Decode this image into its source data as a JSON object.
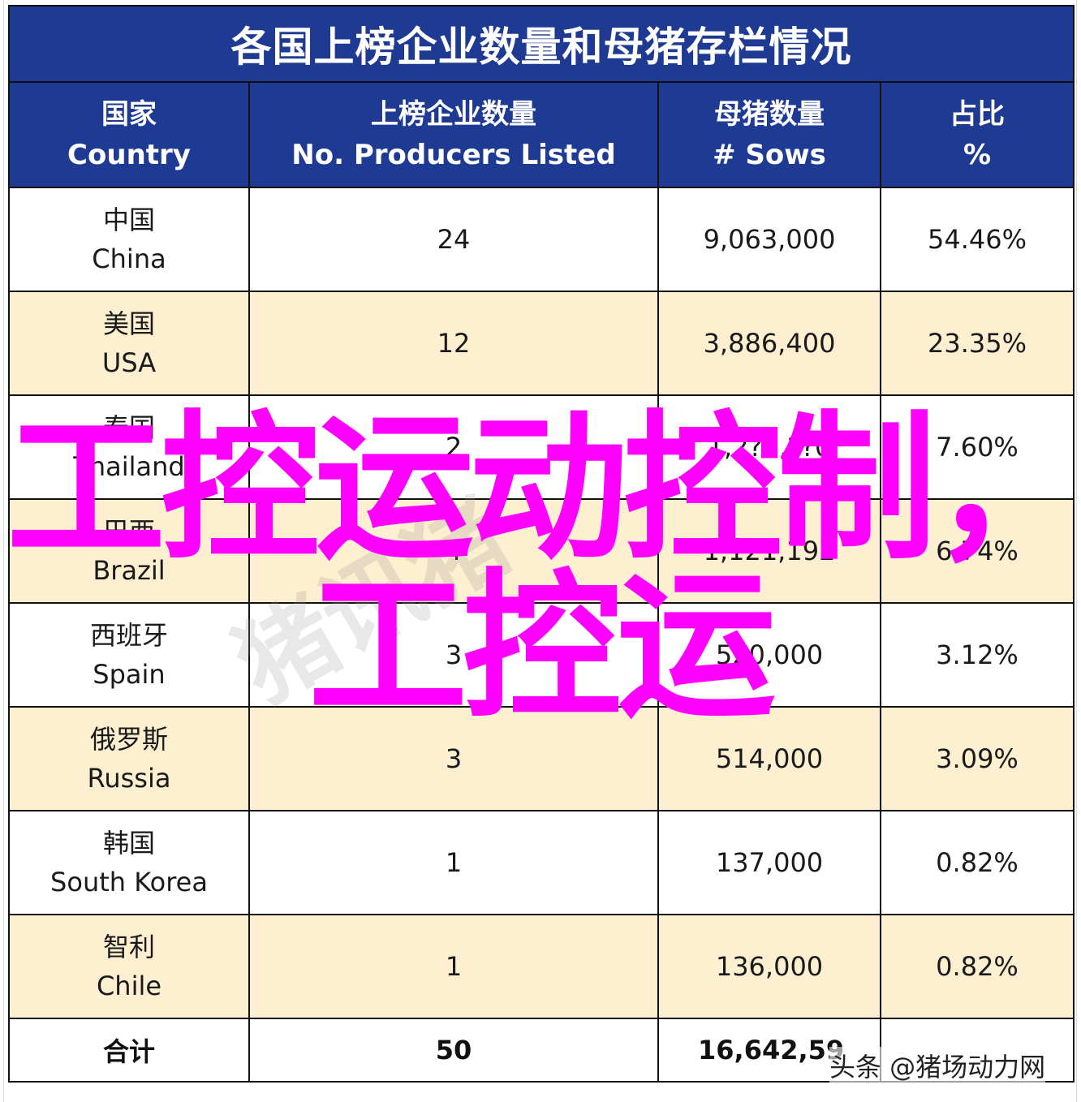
{
  "table": {
    "title": "各国上榜企业数量和母猪存栏情况",
    "headers": [
      {
        "zh": "国家",
        "en": "Country"
      },
      {
        "zh": "上榜企业数量",
        "en": "No. Producers Listed"
      },
      {
        "zh": "母猪数量",
        "en": "# Sows"
      },
      {
        "zh": "占比",
        "en": "%"
      }
    ],
    "rows": [
      {
        "country_zh": "中国",
        "country_en": "China",
        "producers": "24",
        "sows": "9,063,000",
        "share": "54.46%"
      },
      {
        "country_zh": "美国",
        "country_en": "USA",
        "producers": "12",
        "sows": "3,886,400",
        "share": "23.35%"
      },
      {
        "country_zh": "泰国",
        "country_en": "Thailand",
        "producers": "2",
        "sows": "1,2?5,??0",
        "share": "7.60%"
      },
      {
        "country_zh": "巴西",
        "country_en": "Brazil",
        "producers": "4",
        "sows": "1,121,192",
        "share": "6.74%"
      },
      {
        "country_zh": "西班牙",
        "country_en": "Spain",
        "producers": "3",
        "sows": "520,000",
        "share": "3.12%"
      },
      {
        "country_zh": "俄罗斯",
        "country_en": "Russia",
        "producers": "3",
        "sows": "514,000",
        "share": "3.09%"
      },
      {
        "country_zh": "韩国",
        "country_en": "South Korea",
        "producers": "1",
        "sows": "137,000",
        "share": "0.82%"
      },
      {
        "country_zh": "智利",
        "country_en": "Chile",
        "producers": "1",
        "sows": "136,000",
        "share": "0.82%"
      }
    ],
    "total": {
      "label": "合计",
      "producers": "50",
      "sows": "16,642,59",
      "share": ""
    }
  },
  "overlay": {
    "line1": "工控运动控制，",
    "line2": "工控运",
    "color": "#ff00ff"
  },
  "watermark": "猪讯猪",
  "source": "头条 @猪场动力网",
  "colors": {
    "header_bg": "#1f3a93",
    "row_alt_bg": "#fdefcf",
    "row_bg": "#ffffff"
  }
}
